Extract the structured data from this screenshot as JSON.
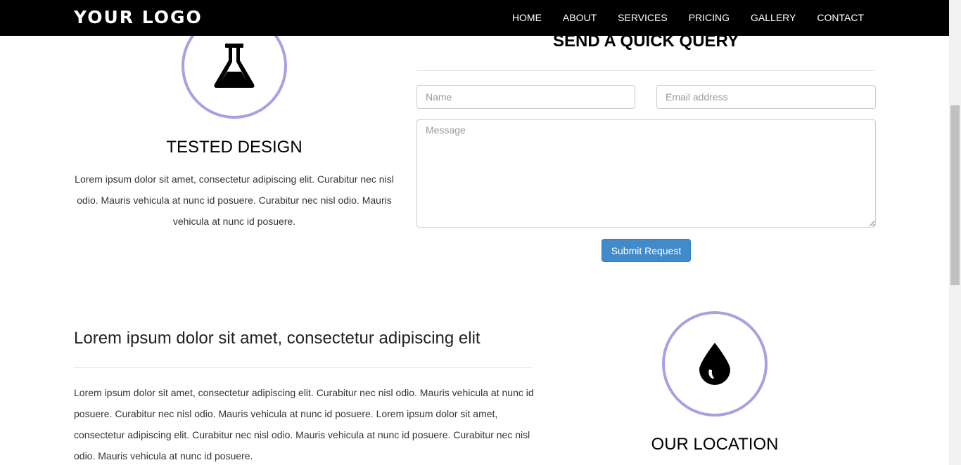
{
  "navbar": {
    "logo": "YOUR LOGO",
    "links": [
      "HOME",
      "ABOUT",
      "SERVICES",
      "PRICING",
      "GALLERY",
      "CONTACT"
    ]
  },
  "features": {
    "tested": {
      "icon": "flask-icon",
      "title": "TESTED DESIGN",
      "text": "Lorem ipsum dolor sit amet, consectetur adipiscing elit. Curabitur nec nisl odio. Mauris vehicula at nunc id posuere. Curabitur nec nisl odio. Mauris vehicula at nunc id posuere."
    },
    "location": {
      "icon": "drop-icon",
      "title": "OUR LOCATION"
    }
  },
  "query": {
    "title": "SEND A QUICK QUERY",
    "name_placeholder": "Name",
    "email_placeholder": "Email address",
    "message_placeholder": "Message",
    "submit_label": "Submit Request"
  },
  "about": {
    "heading": "Lorem ipsum dolor sit amet, consectetur adipiscing elit",
    "body": "Lorem ipsum dolor sit amet, consectetur adipiscing elit. Curabitur nec nisl odio. Mauris vehicula at nunc id posuere. Curabitur nec nisl odio. Mauris vehicula at nunc id posuere. Lorem ipsum dolor sit amet, consectetur adipiscing elit. Curabitur nec nisl odio. Mauris vehicula at nunc id posuere. Curabitur nec nisl odio. Mauris vehicula at nunc id posuere."
  },
  "colors": {
    "navbar_bg": "#000000",
    "circle_border": "#ab9fe4",
    "button_primary": "#428bca"
  }
}
